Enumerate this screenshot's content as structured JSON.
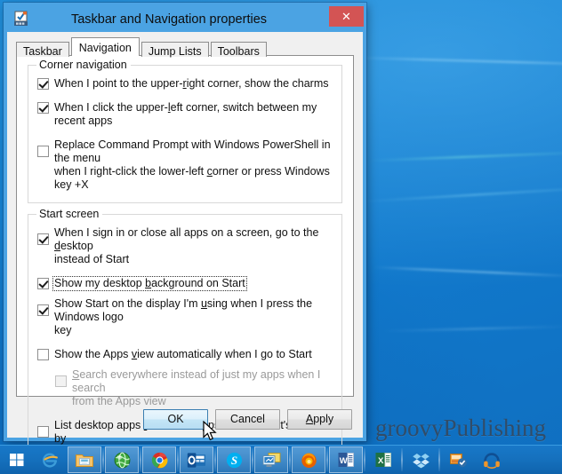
{
  "desktop": {
    "watermark": "groovyPublishing"
  },
  "dialog": {
    "title": "Taskbar and Navigation properties",
    "icon_name": "taskbar-properties-icon",
    "close_label": "✕",
    "tabs": [
      {
        "label": "Taskbar",
        "active": false
      },
      {
        "label": "Navigation",
        "active": true
      },
      {
        "label": "Jump Lists",
        "active": false
      },
      {
        "label": "Toolbars",
        "active": false
      }
    ],
    "groups": [
      {
        "legend": "Corner navigation",
        "options": [
          {
            "label": "When I point to the upper-right corner, show the charms",
            "checked": true,
            "enabled": true,
            "focused": false
          },
          {
            "label": "When I click the upper-left corner, switch between my recent apps",
            "checked": true,
            "enabled": true,
            "focused": false
          },
          {
            "label": "Replace Command Prompt with Windows PowerShell in the menu when I right-click the lower-left corner or press Windows key +X",
            "checked": false,
            "enabled": true,
            "focused": false
          }
        ]
      },
      {
        "legend": "Start screen",
        "options": [
          {
            "label": "When I sign in or close all apps on a screen, go to the desktop instead of Start",
            "checked": true,
            "enabled": true,
            "focused": false
          },
          {
            "label": "Show my desktop background on Start",
            "checked": true,
            "enabled": true,
            "focused": true
          },
          {
            "label": "Show Start on the display I'm using when I press the Windows logo key",
            "checked": true,
            "enabled": true,
            "focused": false
          },
          {
            "label": "Show the Apps view automatically when I go to Start",
            "checked": false,
            "enabled": true,
            "focused": false
          },
          {
            "label": "Search everywhere instead of just my apps when I search from the Apps view",
            "checked": false,
            "enabled": false,
            "focused": false,
            "indent": true
          },
          {
            "label": "List desktop apps first in the Apps view when it's sorted by category",
            "checked": false,
            "enabled": true,
            "focused": false
          }
        ]
      }
    ],
    "buttons": [
      {
        "label": "OK",
        "hover": true
      },
      {
        "label": "Cancel",
        "hover": false
      },
      {
        "label": "Apply",
        "hover": false
      }
    ]
  },
  "taskbar": {
    "items": [
      {
        "name": "start-button",
        "icon": "windows-logo-icon",
        "running": false
      },
      {
        "name": "internet-explorer",
        "icon": "ie-icon",
        "running": false
      },
      {
        "name": "file-explorer",
        "icon": "folder-icon",
        "running": true
      },
      {
        "name": "world-app",
        "icon": "globe-icon",
        "running": true
      },
      {
        "name": "google-chrome",
        "icon": "chrome-icon",
        "running": true
      },
      {
        "name": "microsoft-outlook",
        "icon": "outlook-icon",
        "running": true
      },
      {
        "name": "skype",
        "icon": "skype-icon",
        "running": true
      },
      {
        "name": "remote-desktop",
        "icon": "remote-desktop-icon",
        "running": true
      },
      {
        "name": "mozilla-firefox",
        "icon": "firefox-icon",
        "running": true
      },
      {
        "name": "microsoft-word",
        "icon": "word-icon",
        "running": true
      },
      {
        "name": "microsoft-excel",
        "icon": "excel-icon",
        "running": false
      },
      {
        "name": "dropbox",
        "icon": "dropbox-icon",
        "running": false
      },
      {
        "name": "snagit",
        "icon": "snagit-icon",
        "running": false
      },
      {
        "name": "headphones-app",
        "icon": "headphones-icon",
        "running": false
      }
    ]
  },
  "colors": {
    "window_frame": "#4ba3e3",
    "close_red": "#d35454",
    "dialog_face": "#f0f0f0",
    "desktop_blue": "#1583d4"
  }
}
